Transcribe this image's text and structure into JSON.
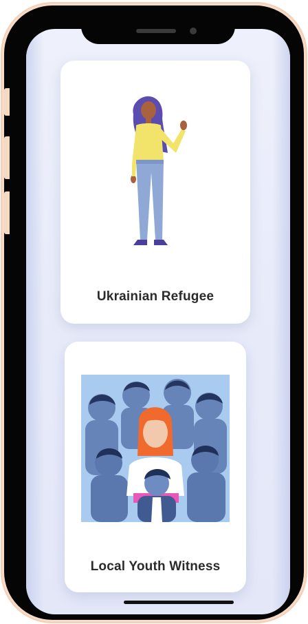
{
  "cards": [
    {
      "label": "Ukrainian Refugee",
      "illustration": "standing-woman-waving"
    },
    {
      "label": "Local Youth Witness",
      "illustration": "crowd-of-youths"
    }
  ],
  "colors": {
    "phone_body": "#050505",
    "phone_rim": "#f6dcc8",
    "screen_bg": "#e6eaf9",
    "card_bg": "#ffffff",
    "label_text": "#2b2b2b"
  }
}
